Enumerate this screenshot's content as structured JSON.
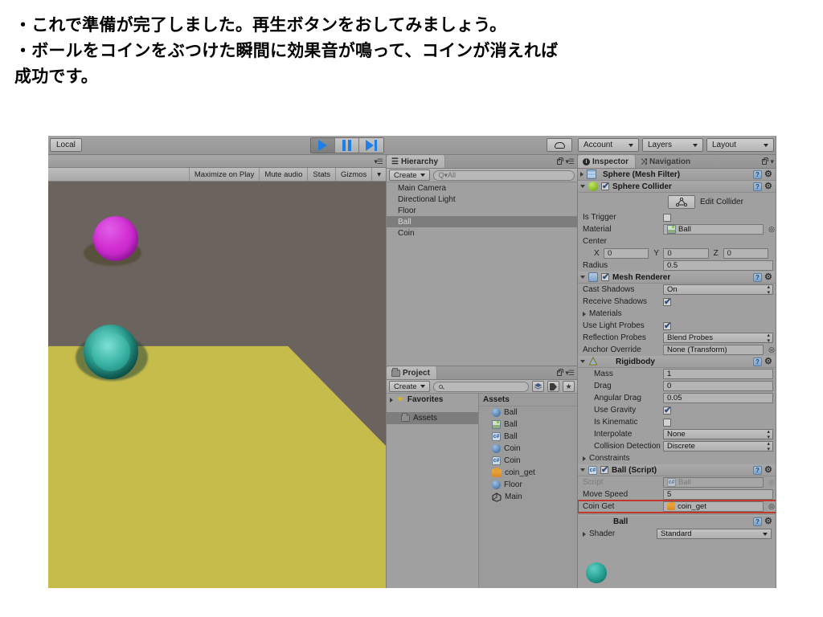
{
  "caption": {
    "line1": "・これで準備が完了しました。再生ボタンをおしてみましょう。",
    "line2": "・ボールをコインをぶつけた瞬間に効果音が鳴って、コインが消えれば",
    "line3": "成功です。"
  },
  "toolbar": {
    "local_label": "Local",
    "play_icon": "play-icon",
    "pause_icon": "pause-icon",
    "step_icon": "step-icon",
    "cloud_icon": "cloud-icon",
    "account_label": "Account",
    "layers_label": "Layers",
    "layout_label": "Layout"
  },
  "game_view": {
    "options_icon": "panel-options-icon",
    "toolbar_items": [
      "Maximize on Play",
      "Mute audio",
      "Stats",
      "Gizmos"
    ],
    "gizmos_caret": "▾",
    "colors": {
      "background": "#6b645e",
      "floor": "#c6bc4c",
      "coin": "#d22fd2",
      "ball": "#2ea294"
    },
    "objects": [
      "coin-sphere",
      "ball-sphere"
    ]
  },
  "hierarchy": {
    "tab_label": "Hierarchy",
    "tab_icon": "hierarchy-icon",
    "lock_icon": "lock-icon",
    "options_icon": "panel-options-icon",
    "create_label": "Create",
    "search_placeholder": "Q▾All",
    "items": [
      {
        "label": "Main Camera",
        "selected": false
      },
      {
        "label": "Directional Light",
        "selected": false
      },
      {
        "label": "Floor",
        "selected": false
      },
      {
        "label": "Ball",
        "selected": true
      },
      {
        "label": "Coin",
        "selected": false
      }
    ]
  },
  "project": {
    "tab_label": "Project",
    "tab_icon": "folder-icon",
    "lock_icon": "lock-icon",
    "options_icon": "panel-options-icon",
    "create_label": "Create",
    "search_placeholder": "",
    "toolbar_icons": [
      "asset-filter-icon",
      "label-filter-icon",
      "favorite-icon"
    ],
    "tree": [
      {
        "label": "Favorites",
        "icon": "star-icon",
        "selected": false,
        "expandable": true
      },
      {
        "label": "Assets",
        "icon": "folder-icon",
        "selected": true,
        "expandable": false
      }
    ],
    "assets_header": "Assets",
    "assets": [
      {
        "label": "Ball",
        "icon": "material-sphere-icon"
      },
      {
        "label": "Ball",
        "icon": "prefab-icon"
      },
      {
        "label": "Ball",
        "icon": "csharp-script-icon"
      },
      {
        "label": "Coin",
        "icon": "material-sphere-icon"
      },
      {
        "label": "Coin",
        "icon": "csharp-script-icon"
      },
      {
        "label": "coin_get",
        "icon": "audio-clip-icon"
      },
      {
        "label": "Floor",
        "icon": "material-sphere-icon"
      },
      {
        "label": "Main",
        "icon": "unity-scene-icon"
      }
    ]
  },
  "inspector": {
    "tabs": [
      {
        "label": "Inspector",
        "icon": "info-icon",
        "active": true
      },
      {
        "label": "Navigation",
        "icon": "navigation-icon",
        "active": false
      }
    ],
    "lock_icon": "lock-icon",
    "options_icon": "panel-options-icon",
    "components": [
      {
        "title": "Sphere (Mesh Filter)",
        "icon": "mesh-filter-icon",
        "expanded": false,
        "has_checkbox": false
      },
      {
        "title": "Sphere Collider",
        "icon": "sphere-collider-icon",
        "expanded": true,
        "has_checkbox": true,
        "checked": true,
        "edit_collider_label": "Edit Collider",
        "rows": [
          {
            "label": "Is Trigger",
            "type": "checkbox",
            "checked": false
          },
          {
            "label": "Material",
            "type": "object",
            "value": "Ball",
            "icon": "material-icon"
          },
          {
            "label": "Center",
            "type": "header"
          },
          {
            "label": "",
            "type": "vector3",
            "x": "0",
            "y": "0",
            "z": "0",
            "axes": [
              "X",
              "Y",
              "Z"
            ]
          },
          {
            "label": "Radius",
            "type": "text",
            "value": "0.5"
          }
        ]
      },
      {
        "title": "Mesh Renderer",
        "icon": "mesh-renderer-icon",
        "expanded": true,
        "has_checkbox": true,
        "checked": true,
        "rows": [
          {
            "label": "Cast Shadows",
            "type": "popup",
            "value": "On"
          },
          {
            "label": "Receive Shadows",
            "type": "checkbox",
            "checked": true
          },
          {
            "label": "Materials",
            "type": "foldout"
          },
          {
            "label": "Use Light Probes",
            "type": "checkbox",
            "checked": true
          },
          {
            "label": "Reflection Probes",
            "type": "popup",
            "value": "Blend Probes"
          },
          {
            "label": "Anchor Override",
            "type": "object",
            "value": "None (Transform)"
          }
        ]
      },
      {
        "title": "Rigidbody",
        "icon": "rigidbody-icon",
        "expanded": true,
        "has_checkbox": false,
        "rows": [
          {
            "label": "Mass",
            "type": "text",
            "value": "1"
          },
          {
            "label": "Drag",
            "type": "text",
            "value": "0"
          },
          {
            "label": "Angular Drag",
            "type": "text",
            "value": "0.05"
          },
          {
            "label": "Use Gravity",
            "type": "checkbox",
            "checked": true
          },
          {
            "label": "Is Kinematic",
            "type": "checkbox",
            "checked": false
          },
          {
            "label": "Interpolate",
            "type": "popup",
            "value": "None"
          },
          {
            "label": "Collision Detection",
            "type": "popup",
            "value": "Discrete"
          },
          {
            "label": "Constraints",
            "type": "foldout"
          }
        ]
      },
      {
        "title": "Ball (Script)",
        "icon": "csharp-script-icon",
        "expanded": true,
        "has_checkbox": true,
        "checked": true,
        "rows": [
          {
            "label": "Script",
            "type": "object-disabled",
            "value": "Ball"
          },
          {
            "label": "Move Speed",
            "type": "text",
            "value": "5"
          },
          {
            "label": "Coin Get",
            "type": "object",
            "value": "coin_get",
            "highlighted": true,
            "icon": "audio-clip-icon"
          }
        ]
      },
      {
        "title": "Ball",
        "icon": "material-preview-icon",
        "is_material": true,
        "shader_label": "Shader",
        "shader_value": "Standard"
      }
    ]
  },
  "accent_colors": {
    "play_blue": "#1f7fe8",
    "highlight_red": "#c0392b",
    "selection_gray": "#7d7d7d",
    "panel_gray": "#a0a0a0"
  }
}
